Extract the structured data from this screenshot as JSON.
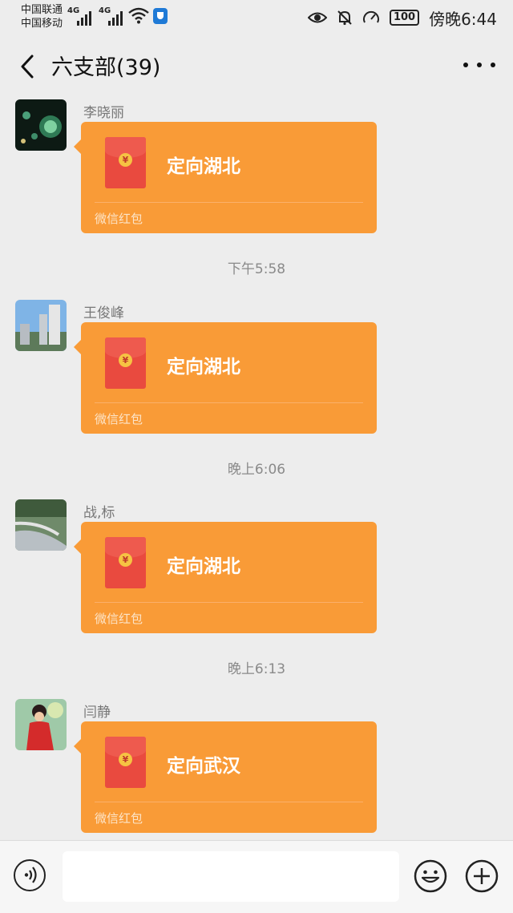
{
  "status_bar": {
    "carrier_1": "中国联通",
    "carrier_2": "中国移动",
    "network_1": "4G",
    "network_2": "4G",
    "battery": "100",
    "time": "傍晚6:44",
    "icons": [
      "signal-icon",
      "wifi-icon",
      "shield-icon",
      "eye-icon",
      "mute-bell-icon",
      "speed-icon",
      "battery-icon"
    ]
  },
  "header": {
    "back_icon": "chevron-left-icon",
    "title": "六支部(39)",
    "more_icon": "more-dots-icon"
  },
  "messages": [
    {
      "sender": "李晓丽",
      "red_packet_text": "定向湖北",
      "red_packet_label": "微信红包",
      "timestamp_before": ""
    },
    {
      "sender": "王俊峰",
      "red_packet_text": "定向湖北",
      "red_packet_label": "微信红包",
      "timestamp_before": "下午5:58"
    },
    {
      "sender": "战,标",
      "red_packet_text": "定向湖北",
      "red_packet_label": "微信红包",
      "timestamp_before": "晚上6:06"
    },
    {
      "sender": "闫静",
      "red_packet_text": "定向武汉",
      "red_packet_label": "微信红包",
      "timestamp_before": "晚上6:13"
    }
  ],
  "red_packet_coin": "¥",
  "input_bar": {
    "placeholder": "",
    "voice_icon": "voice-icon",
    "emoji_icon": "emoji-icon",
    "plus_icon": "plus-icon"
  },
  "colors": {
    "background": "#ededed",
    "red_packet_bubble": "#f99b37",
    "envelope": "#e94a3f"
  }
}
